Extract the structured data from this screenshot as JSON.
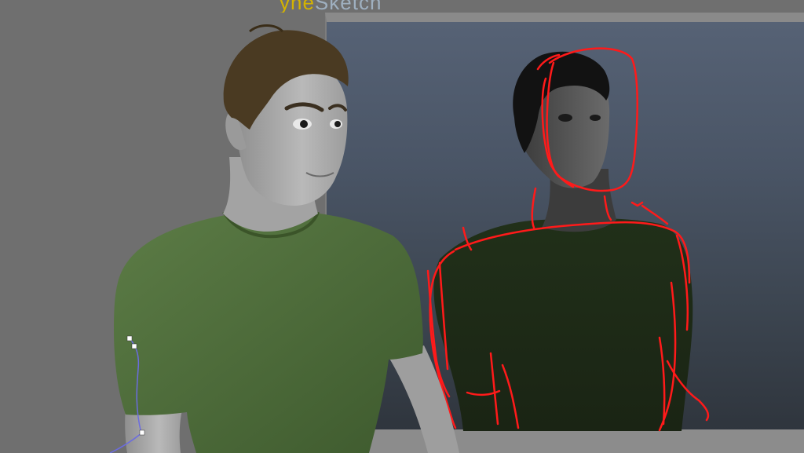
{
  "viewport": {
    "overlay_text": {
      "prefix": "yne",
      "suffix": "Sketch"
    },
    "colors": {
      "background": "#6f6f6f",
      "panel_gradient_top": "#566275",
      "panel_gradient_bottom": "#2f353d",
      "shirt_green": "#4f6d3c",
      "skin_gray": "#a9a9a9",
      "hair_brown": "#4a3a22",
      "sketch_red": "#ff1a1a",
      "rig_line_blue": "#6b6ce0",
      "overlay_yellow": "#d4b300"
    }
  }
}
